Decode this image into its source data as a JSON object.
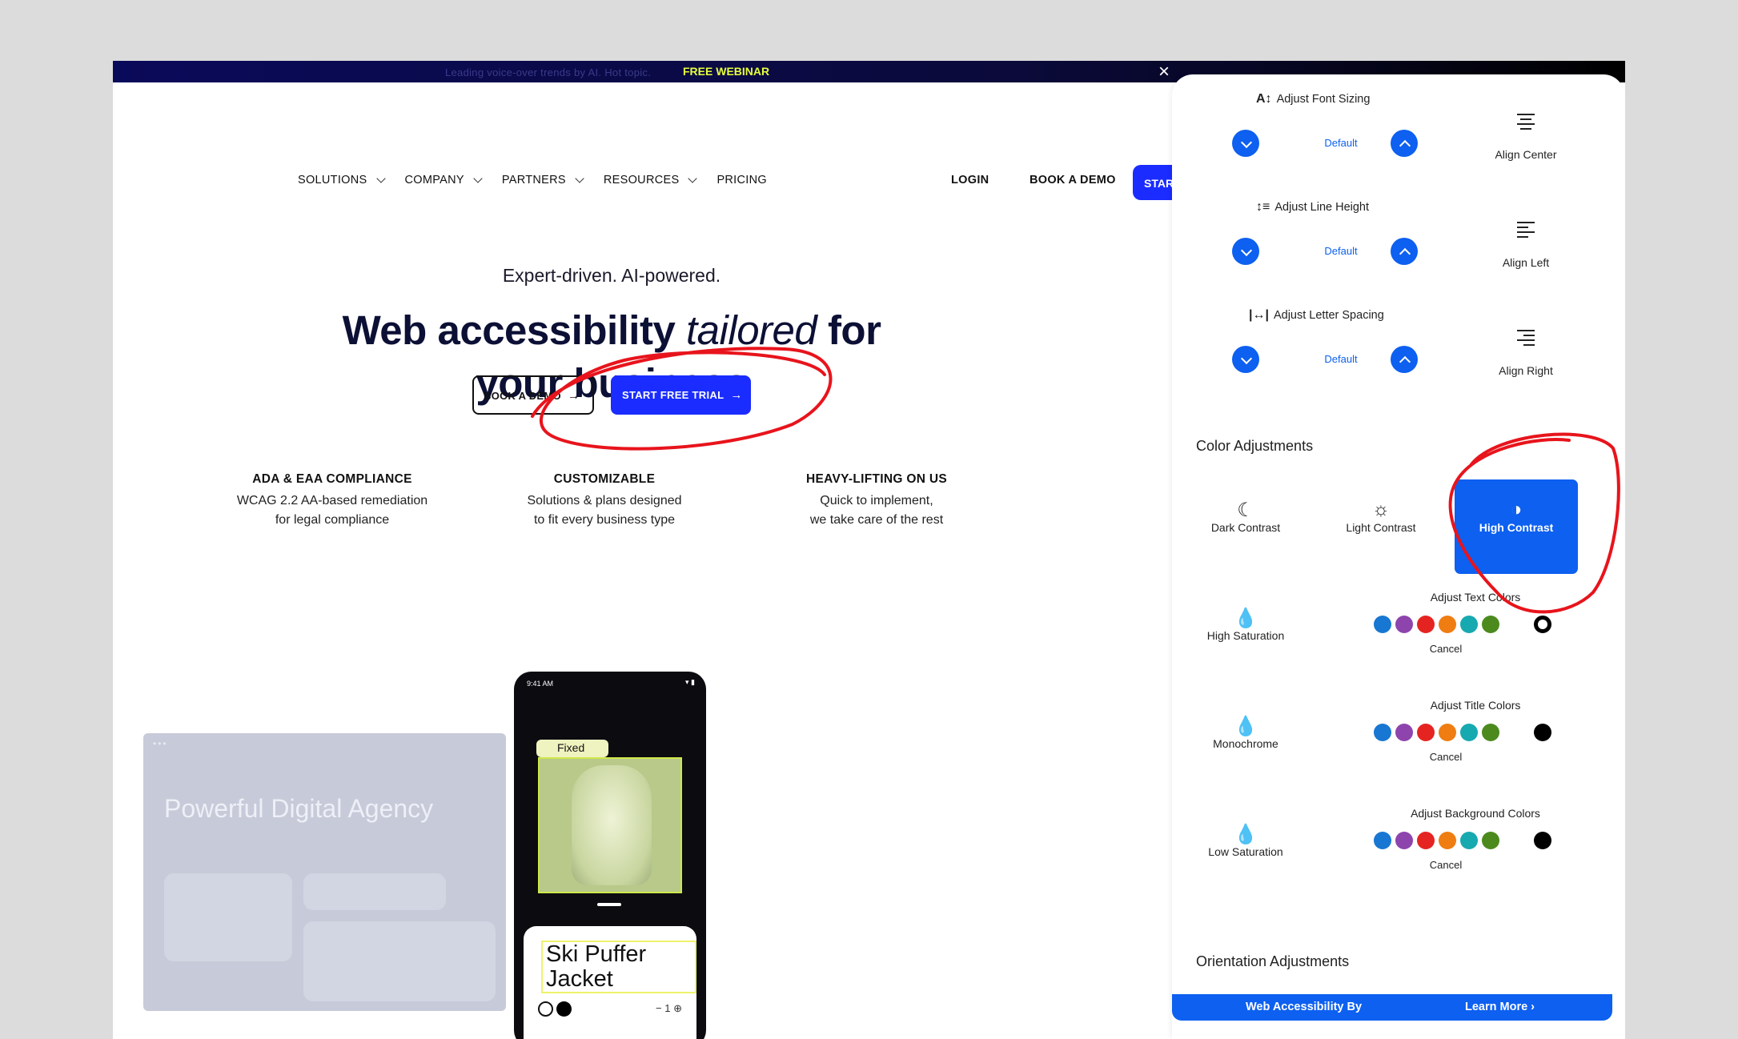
{
  "announcement": {
    "text": "Leading voice-over trends by AI. Hot topic.",
    "badge": "FREE WEBINAR",
    "close": "×"
  },
  "nav": {
    "items": [
      "SOLUTIONS",
      "COMPANY",
      "PARTNERS",
      "RESOURCES",
      "PRICING"
    ],
    "login": "LOGIN",
    "book_demo": "BOOK A DEMO",
    "start": "STAR"
  },
  "hero": {
    "eyebrow": "Expert-driven. AI-powered.",
    "headline_1": "Web accessibility ",
    "headline_italic": "tailored",
    "headline_2": " for your business",
    "btn_demo": "BOOK A DEMO",
    "btn_trial": "START FREE TRIAL",
    "arrow": "→"
  },
  "features": [
    {
      "title": "ADA & EAA COMPLIANCE",
      "line1": "WCAG 2.2 AA-based remediation",
      "line2": "for legal compliance"
    },
    {
      "title": "CUSTOMIZABLE",
      "line1": "Solutions & plans designed",
      "line2": "to fit every business type"
    },
    {
      "title": "HEAVY-LIFTING ON US",
      "line1": "Quick to implement,",
      "line2": "we take care of the rest"
    }
  ],
  "agency": {
    "title": "Powerful Digital Agency",
    "dots": "•••"
  },
  "phone": {
    "time": "9:41 AM",
    "status": "▾ ▮",
    "tag": "Fixed",
    "product": "Ski Puffer Jacket",
    "qty": "− 1 ⊕"
  },
  "panel": {
    "adjustments": [
      {
        "icon": "A↕",
        "title": "Adjust Font Sizing",
        "value": "Default",
        "align_label": "Align Center",
        "align": "center"
      },
      {
        "icon": "↕≡",
        "title": "Adjust Line Height",
        "value": "Default",
        "align_label": "Align Left",
        "align": "left"
      },
      {
        "icon": "|↔|",
        "title": "Adjust Letter Spacing",
        "value": "Default",
        "align_label": "Align Right",
        "align": "right"
      }
    ],
    "color_heading": "Color Adjustments",
    "contrast": [
      {
        "icon": "☾",
        "label": "Dark Contrast"
      },
      {
        "icon": "☼",
        "label": "Light Contrast"
      },
      {
        "icon": "◑",
        "label": "High Contrast"
      }
    ],
    "saturation": [
      {
        "icon": "💧",
        "label": "High Saturation"
      },
      {
        "icon": "💧",
        "label": "Monochrome"
      },
      {
        "icon": "💧",
        "label": "Low Saturation"
      }
    ],
    "palettes": [
      {
        "title": "Adjust Text Colors",
        "cancel": "Cancel"
      },
      {
        "title": "Adjust Title Colors",
        "cancel": "Cancel"
      },
      {
        "title": "Adjust Background Colors",
        "cancel": "Cancel"
      }
    ],
    "palette_colors": [
      "#1877d2",
      "#8e44ad",
      "#e52421",
      "#ef7d12",
      "#17a9b0",
      "#4c8a1e"
    ],
    "orientation_heading": "Orientation Adjustments",
    "footer_by": "Web Accessibility By",
    "footer_learn": "Learn More ›"
  },
  "colors": {
    "brand_blue": "#1a2cff",
    "panel_blue": "#0d60f0",
    "annotation_red": "#e8141c"
  }
}
